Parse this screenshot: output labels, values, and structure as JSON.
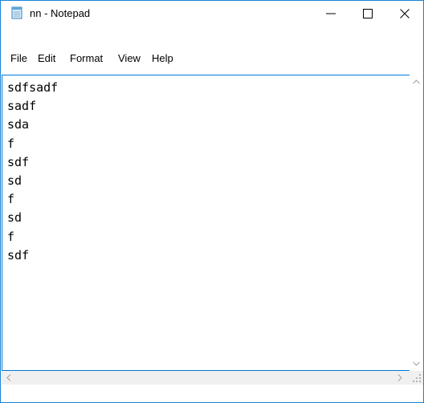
{
  "window": {
    "title": "nn - Notepad",
    "icon": "notepad-icon"
  },
  "controls": {
    "minimize_icon": "minimize-icon",
    "maximize_icon": "maximize-icon",
    "close_icon": "close-icon"
  },
  "menu": {
    "items": [
      {
        "label": "File"
      },
      {
        "label": "Edit"
      },
      {
        "label": "Format"
      },
      {
        "label": "View"
      },
      {
        "label": "Help"
      }
    ]
  },
  "editor": {
    "content": "sdfsadf\nsadf\nsda\nf\nsdf\nsd\nf\nsd\nf\nsdf"
  },
  "colors": {
    "border_accent": "#0078d7",
    "scrollbar_bg": "#f0f0f0",
    "arrow": "#a0a0a0"
  }
}
